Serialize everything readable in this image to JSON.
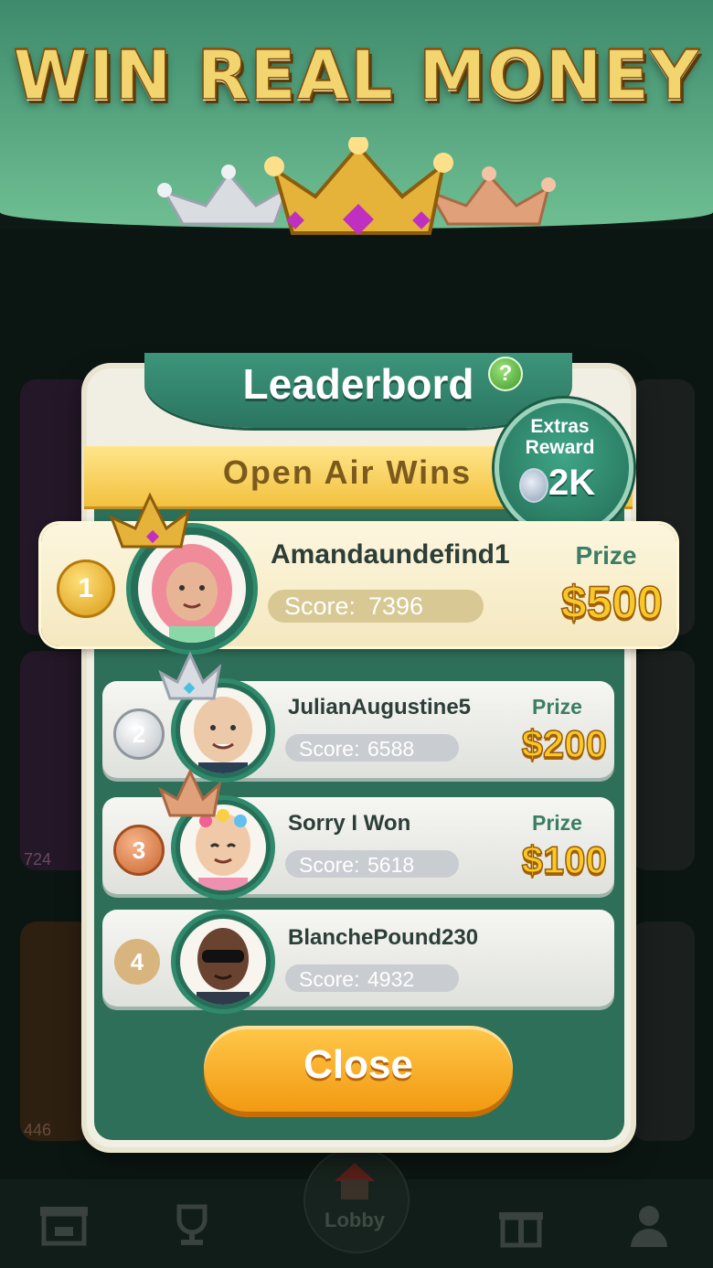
{
  "banner": {
    "headline": "WIN REAL MONEY"
  },
  "modal": {
    "title": "Leaderbord",
    "help_icon": "?",
    "subtitle": "Open Air Wins",
    "reward": {
      "label": "Extras Reward",
      "value": "2K",
      "icon": "silver-coin-icon"
    }
  },
  "leaderboard": [
    {
      "rank": "1",
      "name": "Amandaundefind1",
      "score_label": "Score:",
      "score": "7396",
      "prize_label": "Prize",
      "prize": "$500",
      "crown": "gold"
    },
    {
      "rank": "2",
      "name": "JulianAugustine5",
      "score_label": "Score:",
      "score": "6588",
      "prize_label": "Prize",
      "prize": "$200",
      "crown": "silver"
    },
    {
      "rank": "3",
      "name": "Sorry I Won",
      "score_label": "Score:",
      "score": "5618",
      "prize_label": "Prize",
      "prize": "$100",
      "crown": "bronze"
    },
    {
      "rank": "4",
      "name": "BlanchePound230",
      "score_label": "Score:",
      "score": "4932"
    }
  ],
  "close_label": "Close",
  "background": {
    "card_counts": [
      "724",
      "446"
    ]
  },
  "nav": {
    "lobby_label": "Lobby",
    "items": [
      "store-icon",
      "trophy-icon",
      "home-icon",
      "gift-icon",
      "profile-icon"
    ]
  },
  "colors": {
    "primary_green": "#2e6f5a",
    "gold": "#f8c728",
    "button_orange": "#f29a12"
  }
}
